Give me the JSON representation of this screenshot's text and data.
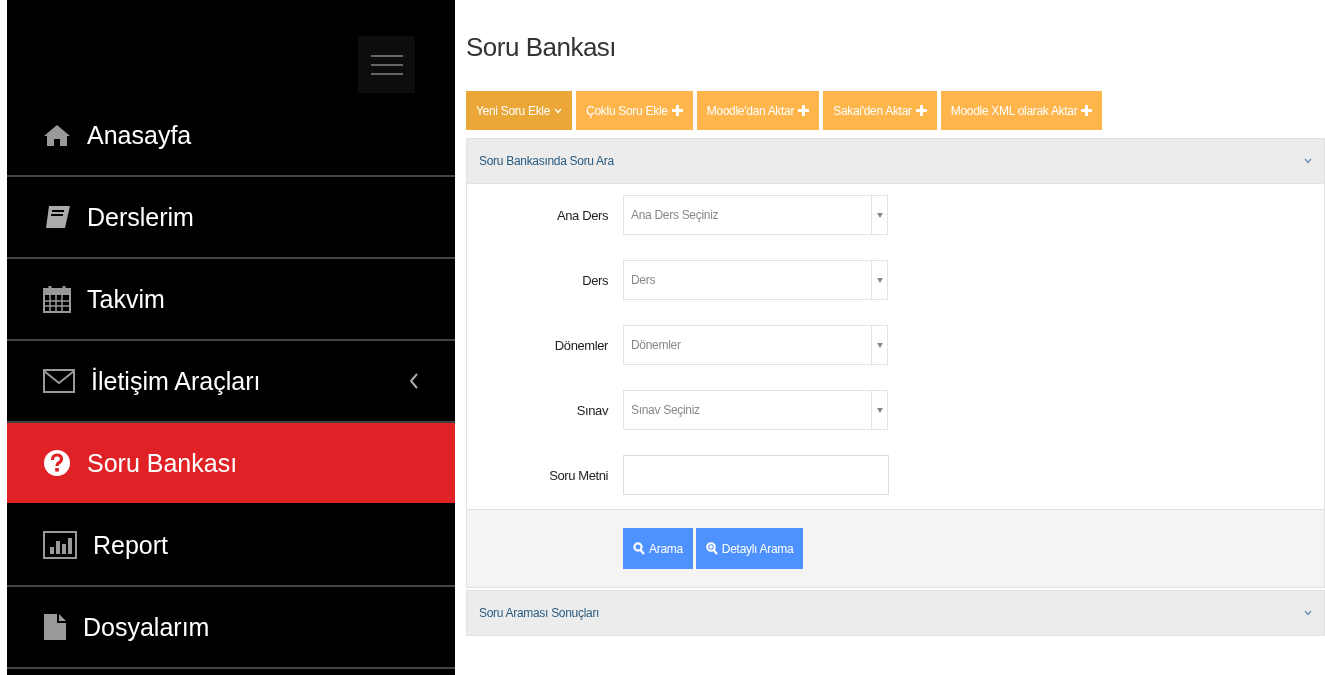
{
  "sidebar": {
    "items": [
      {
        "label": "Anasayfa",
        "kind": "home",
        "selected": false
      },
      {
        "label": "Derslerim",
        "kind": "book",
        "selected": false
      },
      {
        "label": "Takvim",
        "kind": "calendar",
        "selected": false
      },
      {
        "label": "İletişim Araçları",
        "kind": "mail",
        "selected": false,
        "expandable": true
      },
      {
        "label": "Soru Bankası",
        "kind": "question",
        "selected": true
      },
      {
        "label": "Report",
        "kind": "chart",
        "selected": false
      },
      {
        "label": "Dosyalarım",
        "kind": "file",
        "selected": false
      }
    ]
  },
  "page_title": "Soru Bankası",
  "toolbar": [
    {
      "label": "Yeni Soru Ekle",
      "kind": "dropdown"
    },
    {
      "label": "Çoklu Soru Ekle",
      "kind": "add"
    },
    {
      "label": "Moodle'dan Aktar",
      "kind": "add"
    },
    {
      "label": "Sakai'den Aktar",
      "kind": "add"
    },
    {
      "label": "Moodle XML olarak Aktar",
      "kind": "add"
    }
  ],
  "search_panel": {
    "title": "Soru Bankasında Soru Ara",
    "fields": [
      {
        "label": "Ana Ders",
        "kind": "select",
        "placeholder": "Ana Ders Seçiniz"
      },
      {
        "label": "Ders",
        "kind": "select",
        "placeholder": "Ders"
      },
      {
        "label": "Dönemler",
        "kind": "select",
        "placeholder": "Dönemler"
      },
      {
        "label": "Sınav",
        "kind": "select",
        "placeholder": "Sınav Seçiniz"
      },
      {
        "label": "Soru Metni",
        "kind": "text"
      }
    ],
    "buttons": [
      {
        "label": "Arama",
        "kind": "search"
      },
      {
        "label": "Detaylı Arama",
        "kind": "zoom"
      }
    ]
  },
  "results_panel": {
    "title": "Soru Araması Sonuçları"
  }
}
